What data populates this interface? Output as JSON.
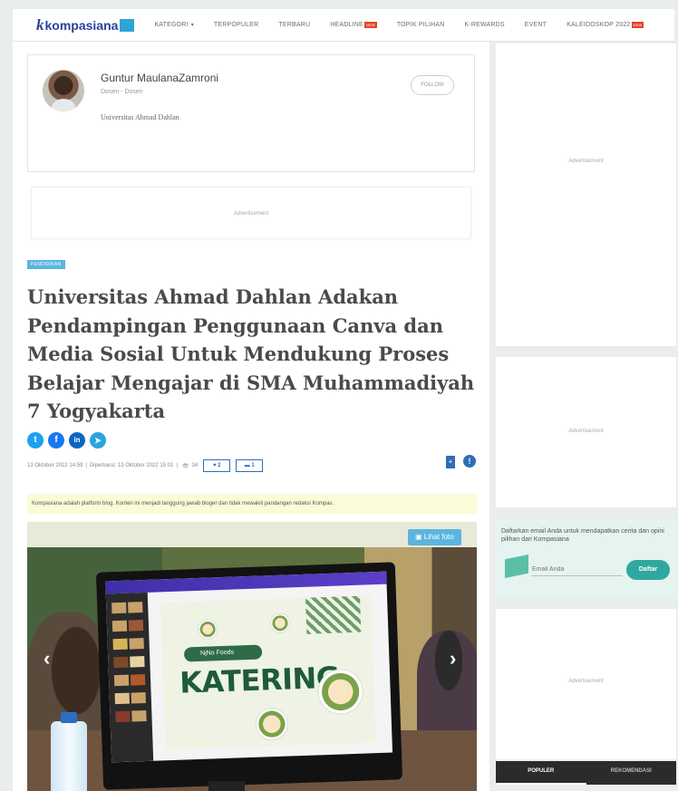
{
  "nav": {
    "logo_text": "kompasiana",
    "logo_badge": "",
    "items": [
      {
        "label": "Kategori",
        "has_caret": true
      },
      {
        "label": "Terpopuler"
      },
      {
        "label": "Terbaru"
      },
      {
        "label": "Headline",
        "badge": "NEW"
      },
      {
        "label": "Topik Pilihan"
      },
      {
        "label": "K-Rewards"
      },
      {
        "label": "Event"
      },
      {
        "label": "Kaleidoskop 2022",
        "badge": "NEW"
      }
    ]
  },
  "author": {
    "name": "Guntur MaulanaZamroni",
    "role": "Dosen - Dosen",
    "bio": "Universitas Ahmad Dahlan",
    "follow_label": "Follow"
  },
  "ads": {
    "label": "Advertisement"
  },
  "article": {
    "category": "Pendidikan",
    "title": "Universitas Ahmad Dahlan Adakan Pendampingan Penggunaan Canva dan Media Sosial Untuk Mendukung Proses Belajar Mengajar di SMA Muhammadiyah 7 Yogyakarta",
    "published": "13 Oktober 2022   14:59",
    "updated": "Diperbarui: 13 Oktober 2022   15:01",
    "views": "34",
    "likes": "2",
    "comments": "1",
    "disclaimer": "Kompasiana adalah platform blog. Konten ini menjadi tanggung jawab bloger dan tidak mewakili pandangan redaksi Kompas.",
    "photo_button": "Lihat foto",
    "photo_screen_text": "KATERING",
    "photo_brand_text": "NjNo Foods"
  },
  "share_icons": [
    "twitter-icon",
    "facebook-icon",
    "linkedin-icon",
    "telegram-icon"
  ],
  "newsletter": {
    "text": "Daftarkan email Anda untuk mendapatkan cerita dan opini pilihan dari Kompasiana",
    "placeholder": "Email Anda",
    "button": "Daftar"
  },
  "side_tabs": [
    "Populer",
    "Rekomendasi"
  ],
  "colors": {
    "brand": "#2f3f9a",
    "accent": "#2f6eb5",
    "category": "#5bb5e0",
    "newsletter_button": "#2fa9a0"
  }
}
